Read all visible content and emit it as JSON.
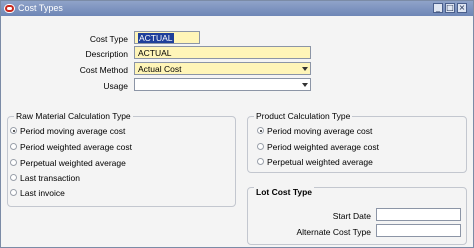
{
  "window": {
    "title": "Cost Types",
    "buttons": {
      "minimize": "_",
      "maximize": "□",
      "close": "×"
    }
  },
  "form": {
    "cost_type": {
      "label": "Cost Type",
      "value": "ACTUAL"
    },
    "description": {
      "label": "Description",
      "value": "ACTUAL"
    },
    "cost_method": {
      "label": "Cost Method",
      "value": "Actual Cost"
    },
    "usage": {
      "label": "Usage",
      "value": ""
    }
  },
  "raw_material": {
    "title": "Raw Material Calculation Type",
    "options": [
      {
        "label": "Period moving average cost",
        "selected": true
      },
      {
        "label": "Period weighted average cost",
        "selected": false
      },
      {
        "label": "Perpetual weighted average",
        "selected": false
      },
      {
        "label": "Last transaction",
        "selected": false
      },
      {
        "label": "Last invoice",
        "selected": false
      }
    ]
  },
  "product": {
    "title": "Product Calculation Type",
    "options": [
      {
        "label": "Period moving average cost",
        "selected": true
      },
      {
        "label": "Period weighted average cost",
        "selected": false
      },
      {
        "label": "Perpetual weighted average",
        "selected": false
      }
    ]
  },
  "lot_cost": {
    "title": "Lot Cost Type",
    "start_date": {
      "label": "Start Date",
      "value": ""
    },
    "alternate_cost_type": {
      "label": "Alternate Cost Type",
      "value": ""
    }
  }
}
